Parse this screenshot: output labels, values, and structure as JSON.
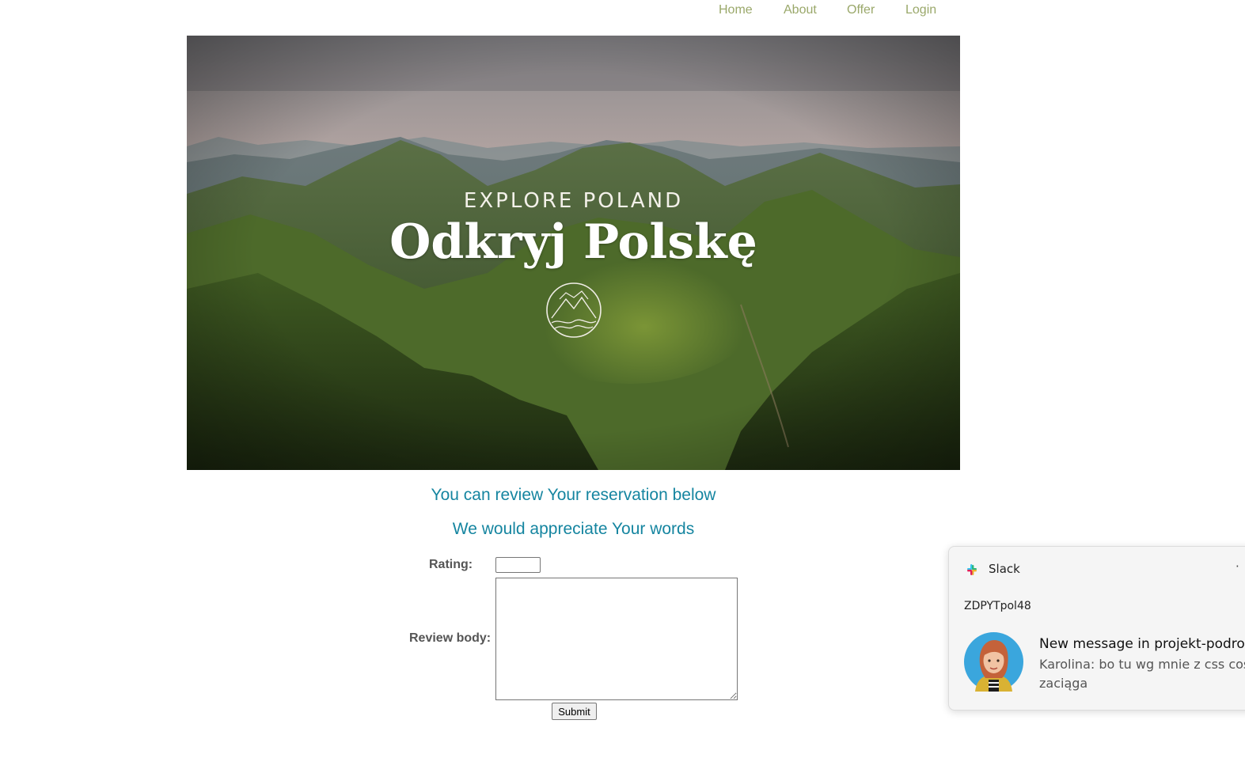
{
  "nav": {
    "items": [
      {
        "label": "Home"
      },
      {
        "label": "About"
      },
      {
        "label": "Offer"
      },
      {
        "label": "Login"
      }
    ]
  },
  "hero": {
    "subtitle": "EXPLORE POLAND",
    "title": "Odkryj Polskę"
  },
  "main": {
    "heading1": "You can review Your reservation below",
    "heading2": "We would appreciate Your words"
  },
  "form": {
    "rating_label": "Rating:",
    "rating_value": "",
    "review_label": "Review body:",
    "review_value": "",
    "submit_label": "Submit"
  },
  "notification": {
    "app": "Slack",
    "more": "·",
    "workspace": "ZDPYTpol48",
    "title": "New message in projekt-podroze",
    "body": "Karolina: bo tu wg mnie z css coś zaciąga"
  },
  "colors": {
    "nav_link": "#9aa86a",
    "heading": "#1585a0",
    "label": "#555555"
  }
}
